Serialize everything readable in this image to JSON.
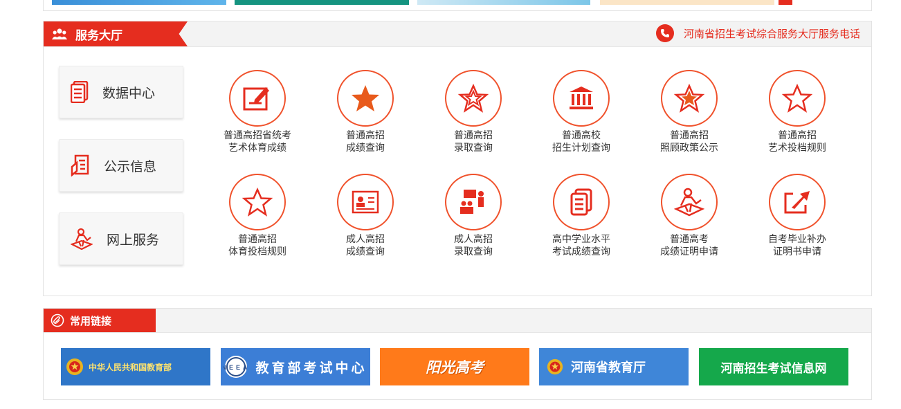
{
  "hall": {
    "title": "服务大厅",
    "hotline": "河南省招生考试综合服务大厅服务电话"
  },
  "side_menu": [
    {
      "label": "数据中心",
      "icon": "document-stack-icon"
    },
    {
      "label": "公示信息",
      "icon": "notice-icon"
    },
    {
      "label": "网上服务",
      "icon": "person-service-icon"
    }
  ],
  "services": [
    {
      "line1": "普通高招省统考",
      "line2": "艺术体育成绩",
      "icon": "edit-form-icon"
    },
    {
      "line1": "普通高招",
      "line2": "成绩查询",
      "icon": "filled-star-icon"
    },
    {
      "line1": "普通高招",
      "line2": "录取查询",
      "icon": "star-outline-icon"
    },
    {
      "line1": "普通高校",
      "line2": "招生计划查询",
      "icon": "institution-icon"
    },
    {
      "line1": "普通高招",
      "line2": "照顾政策公示",
      "icon": "star-badge-icon"
    },
    {
      "line1": "普通高招",
      "line2": "艺术投档规则",
      "icon": "star-outline-icon"
    },
    {
      "line1": "普通高招",
      "line2": "体育投档规则",
      "icon": "star-outline-icon"
    },
    {
      "line1": "成人高招",
      "line2": "成绩查询",
      "icon": "certificate-icon"
    },
    {
      "line1": "成人高招",
      "line2": "录取查询",
      "icon": "meeting-icon"
    },
    {
      "line1": "高中学业水平",
      "line2": "考试成绩查询",
      "icon": "document-stack-icon"
    },
    {
      "line1": "普通高考",
      "line2": "成绩证明申请",
      "icon": "person-service-icon"
    },
    {
      "line1": "自考毕业补办",
      "line2": "证明书申请",
      "icon": "share-arrow-icon"
    }
  ],
  "links": {
    "title": "常用链接",
    "items": [
      {
        "text": "中华人民共和国教育部",
        "bg": "#2f76c8"
      },
      {
        "text": "教育部考试中心",
        "bg": "#3c7ed6"
      },
      {
        "text": "阳光高考",
        "bg": "#ff7a1a"
      },
      {
        "text": "河南省教育厅",
        "bg": "#3f86d8"
      },
      {
        "text": "河南招生考试信息网",
        "bg": "#15a84b"
      }
    ]
  },
  "colors": {
    "accent": "#e52d1f",
    "icon_orange": "#f0522c"
  }
}
